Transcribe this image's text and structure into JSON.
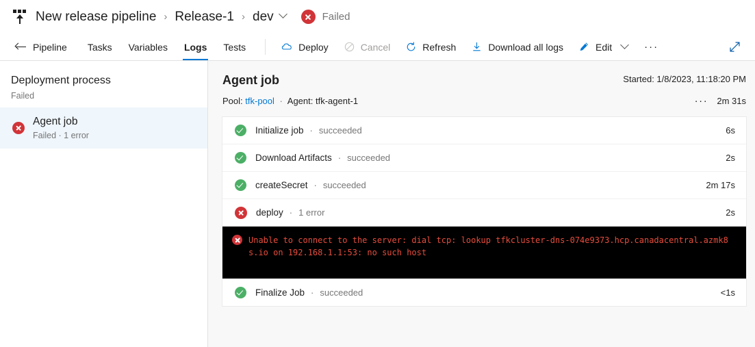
{
  "breadcrumb": {
    "icon": "release-pipeline-icon",
    "items": [
      {
        "label": "New release pipeline"
      },
      {
        "label": "Release-1"
      },
      {
        "label": "dev"
      }
    ],
    "separator": "›",
    "stage_has_dropdown": true,
    "status": {
      "icon": "error-circle-icon",
      "label": "Failed",
      "color": "#d13438"
    }
  },
  "toolbar": {
    "back": {
      "icon": "arrow-left-icon",
      "label": "Pipeline"
    },
    "tabs": [
      {
        "label": "Tasks",
        "active": false
      },
      {
        "label": "Variables",
        "active": false
      },
      {
        "label": "Logs",
        "active": true
      },
      {
        "label": "Tests",
        "active": false
      }
    ],
    "actions": [
      {
        "icon": "cloud-icon",
        "label": "Deploy",
        "disabled": false
      },
      {
        "icon": "cancel-icon",
        "label": "Cancel",
        "disabled": true
      },
      {
        "icon": "refresh-icon",
        "label": "Refresh",
        "disabled": false
      },
      {
        "icon": "download-icon",
        "label": "Download all logs",
        "disabled": false
      },
      {
        "icon": "pencil-icon",
        "label": "Edit",
        "disabled": false,
        "has_chevron": true
      },
      {
        "icon": "more-icon",
        "label": "···",
        "disabled": false
      }
    ],
    "expand": {
      "icon": "expand-diagonal-icon"
    },
    "accent_color": "#0078d4"
  },
  "sidebar": {
    "section": {
      "title": "Deployment process",
      "status": "Failed"
    },
    "items": [
      {
        "icon": "error-circle-icon",
        "title": "Agent job",
        "subtitle": "Failed · 1 error",
        "selected": true
      }
    ]
  },
  "job": {
    "title": "Agent job",
    "started": "Started: 1/8/2023, 11:18:20 PM",
    "pool_prefix": "Pool:",
    "pool_name": "tfk-pool",
    "sep": "·",
    "agent": "Agent: tfk-agent-1",
    "more_icon": "ellipsis-icon",
    "duration": "2m 31s"
  },
  "tasks": [
    {
      "icon": "success-circle-icon",
      "name": "Initialize job",
      "sep": "·",
      "state": "succeeded",
      "duration": "6s"
    },
    {
      "icon": "success-circle-icon",
      "name": "Download Artifacts",
      "sep": "·",
      "state": "succeeded",
      "duration": "2s"
    },
    {
      "icon": "success-circle-icon",
      "name": "createSecret",
      "sep": "·",
      "state": "succeeded",
      "duration": "2m 17s"
    },
    {
      "icon": "error-circle-icon",
      "name": "deploy",
      "sep": "·",
      "state": "1 error",
      "duration": "2s"
    }
  ],
  "console": {
    "icon": "error-circle-icon",
    "text": "Unable to connect to the server: dial tcp: lookup tfkcluster-dns-074e9373.hcp.canadacentral.azmk8s.io on 192.168.1.1:53: no such host",
    "background": "#000000",
    "text_color": "#e74c3c"
  },
  "final_task": {
    "icon": "success-circle-icon",
    "name": "Finalize Job",
    "sep": "·",
    "state": "succeeded",
    "duration": "<1s"
  }
}
